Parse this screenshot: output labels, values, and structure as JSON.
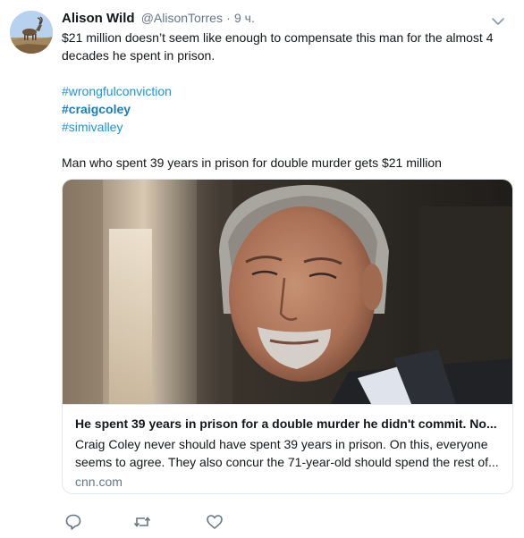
{
  "author": {
    "name": "Alison Wild",
    "handle": "@AlisonTorres",
    "separator": "·",
    "time": "9 ч."
  },
  "tweet": {
    "text": "$21 million doesn’t seem like enough to compensate this man for the almost 4 decades he spent in prison.",
    "hashtags": [
      "#wrongfulconviction",
      "#craigcoley",
      "#simivalley"
    ],
    "headline_line": "Man who spent 39 years in prison for double murder gets $21 million"
  },
  "card": {
    "title": "He spent 39 years in prison for a double murder he didn't commit. No...",
    "description": "Craig Coley never should have spent 39 years in prison. On this, everyone seems to agree. They also concur the 71-year-old should spend the rest of...",
    "domain": "cnn.com"
  },
  "icons": {
    "reply": "reply-icon",
    "retweet": "retweet-icon",
    "like": "heart-icon",
    "more": "chevron-down-icon"
  },
  "colors": {
    "link": "#1b95e0",
    "muted": "#657786",
    "border": "#e1e8ed"
  }
}
